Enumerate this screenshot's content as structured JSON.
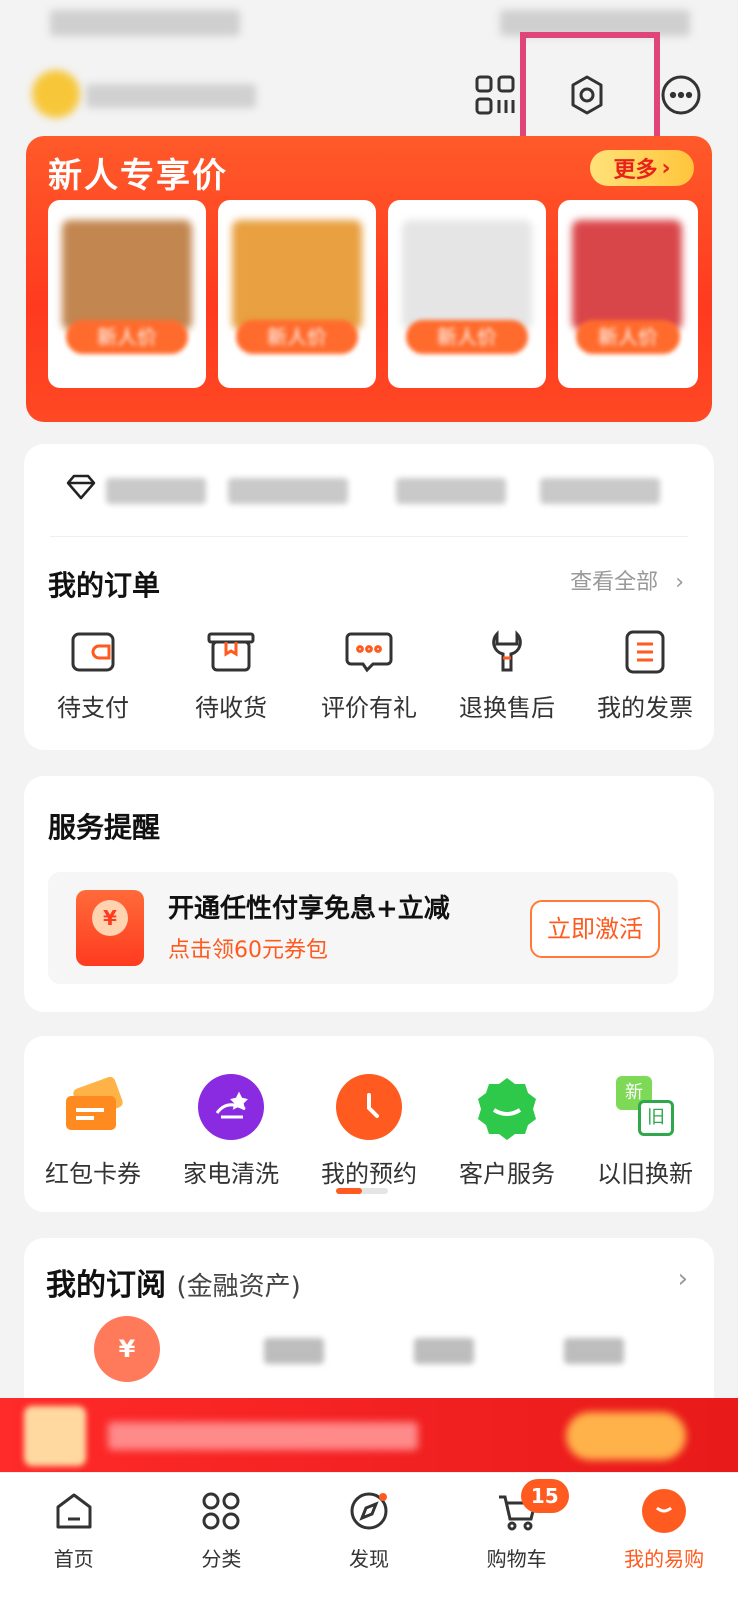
{
  "header": {
    "icons": [
      "scan-icon",
      "settings-icon",
      "more-icon"
    ]
  },
  "promo": {
    "title": "新人专享价",
    "more_label": "更多",
    "card_tag": "新人价",
    "card_tags": [
      "新人价",
      "新人价",
      "新人价",
      "新人价"
    ]
  },
  "orders": {
    "title": "我的订单",
    "see_all": "查看全部",
    "items": [
      {
        "label": "待支付",
        "icon": "wallet-icon"
      },
      {
        "label": "待收货",
        "icon": "package-icon"
      },
      {
        "label": "评价有礼",
        "icon": "comment-icon"
      },
      {
        "label": "退换售后",
        "icon": "wrench-icon"
      },
      {
        "label": "我的发票",
        "icon": "invoice-icon"
      }
    ]
  },
  "service": {
    "title": "服务提醒",
    "main": "开通任性付享免息+立减",
    "sub": "点击领60元券包",
    "button": "立即激活",
    "coin": "¥"
  },
  "quick": {
    "items": [
      {
        "label": "红包卡券",
        "icon": "coupon-icon",
        "color": "#ff8a1f"
      },
      {
        "label": "家电清洗",
        "icon": "cleaning-icon",
        "color": "#8a2be2"
      },
      {
        "label": "我的预约",
        "icon": "clock-icon",
        "color": "#ff5a1f"
      },
      {
        "label": "客户服务",
        "icon": "service-icon",
        "color": "#2ec84a"
      },
      {
        "label": "以旧换新",
        "icon": "trade-in-icon",
        "color": "#3bbd4a"
      }
    ],
    "trade_new": "新",
    "trade_old": "旧"
  },
  "subscription": {
    "title": "我的订阅",
    "subtitle": "(金融资产)",
    "bag_symbol": "¥"
  },
  "tabbar": {
    "items": [
      {
        "label": "首页",
        "icon": "home-icon"
      },
      {
        "label": "分类",
        "icon": "category-icon"
      },
      {
        "label": "发现",
        "icon": "discover-icon"
      },
      {
        "label": "购物车",
        "icon": "cart-icon"
      },
      {
        "label": "我的易购",
        "icon": "profile-icon"
      }
    ],
    "cart_badge": "15",
    "active": "我的易购"
  },
  "colors": {
    "accent": "#ff5a1f",
    "promo_bg": "#ff3a1f",
    "highlight": "#e0457a"
  }
}
